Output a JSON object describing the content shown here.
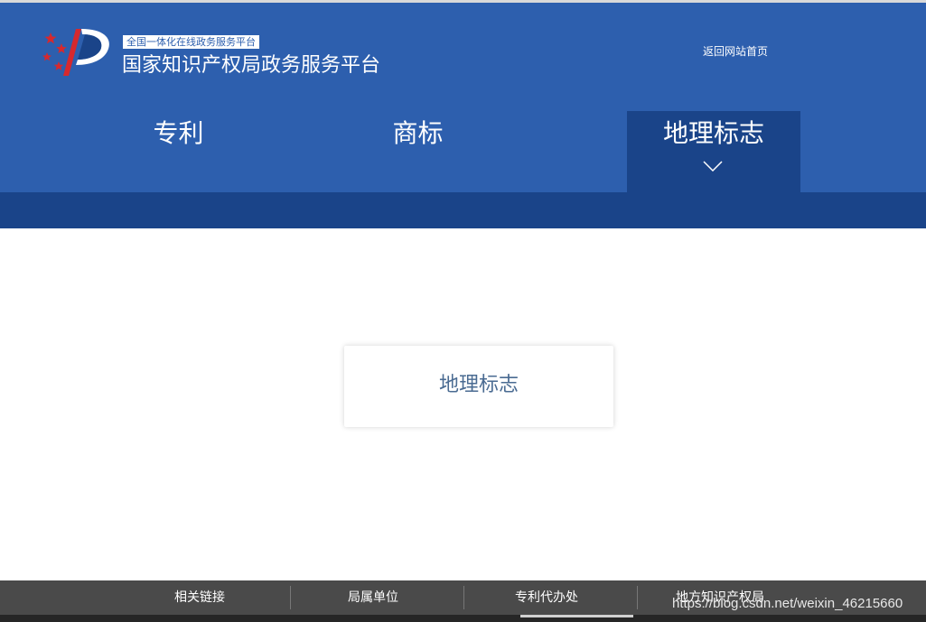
{
  "header": {
    "badge": "全国一体化在线政务服务平台",
    "title": "国家知识产权局政务服务平台",
    "home_link": "返回网站首页"
  },
  "nav": {
    "items": [
      {
        "label": "专利",
        "active": false
      },
      {
        "label": "商标",
        "active": false
      },
      {
        "label": "地理标志",
        "active": true
      }
    ]
  },
  "main": {
    "card_label": "地理标志"
  },
  "footer": {
    "links": [
      "相关链接",
      "局属单位",
      "专利代办处",
      "地方知识产权局"
    ]
  },
  "watermark": "https://blog.csdn.net/weixin_46215660",
  "colors": {
    "header_bg": "#2d5fae",
    "header_dark": "#1a4489",
    "card_text": "#4a6b92",
    "footer_bg": "#4a4a4a"
  }
}
